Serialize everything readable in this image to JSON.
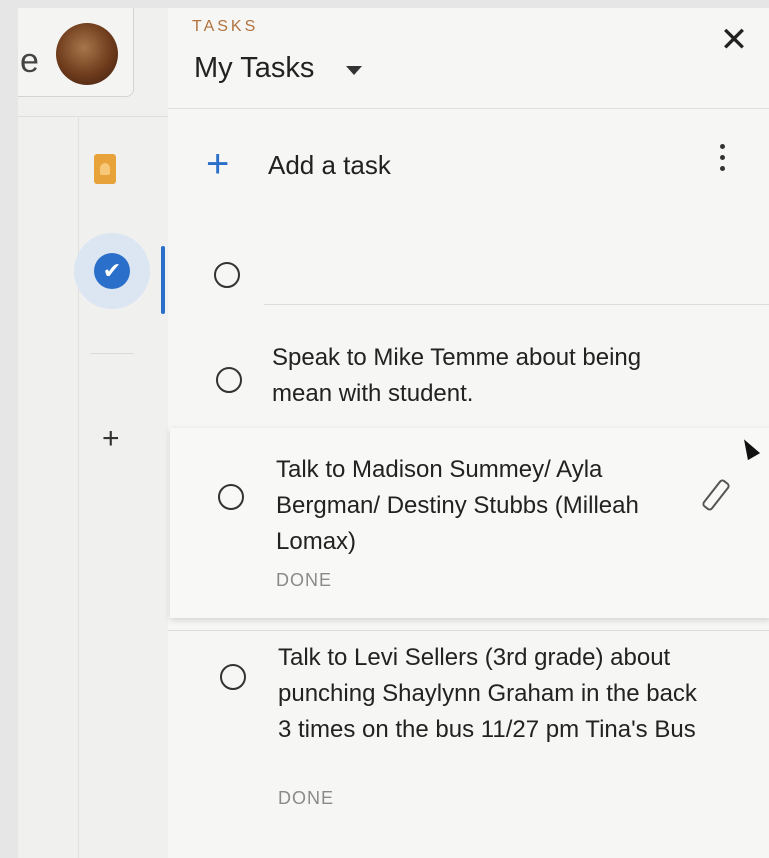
{
  "rail": {
    "partial_title_letter": "e",
    "icons": [
      "avatar",
      "keep-icon",
      "tasks-icon",
      "add-icon"
    ]
  },
  "panel": {
    "subtitle": "TASKS",
    "title": "My Tasks",
    "add_task_label": "Add a task",
    "close_glyph": "✕",
    "add_glyph": "+",
    "rail_add_glyph": "+",
    "check_glyph": "✔"
  },
  "tasks": [
    {
      "text": "Speak to Mike Temme about being mean with student.",
      "status": ""
    },
    {
      "text": "Talk to Madison Summey/ Ayla Bergman/ Destiny Stubbs (Milleah Lomax)",
      "status": "DONE"
    },
    {
      "text": "Talk to Levi Sellers (3rd grade) about punching Shaylynn Graham in the back 3 times on the bus 11/27 pm Tina's Bus",
      "status": "DONE"
    }
  ],
  "colors": {
    "accent": "#2a6fc9",
    "subtitle": "#b0733f",
    "keep": "#e8a23a"
  }
}
